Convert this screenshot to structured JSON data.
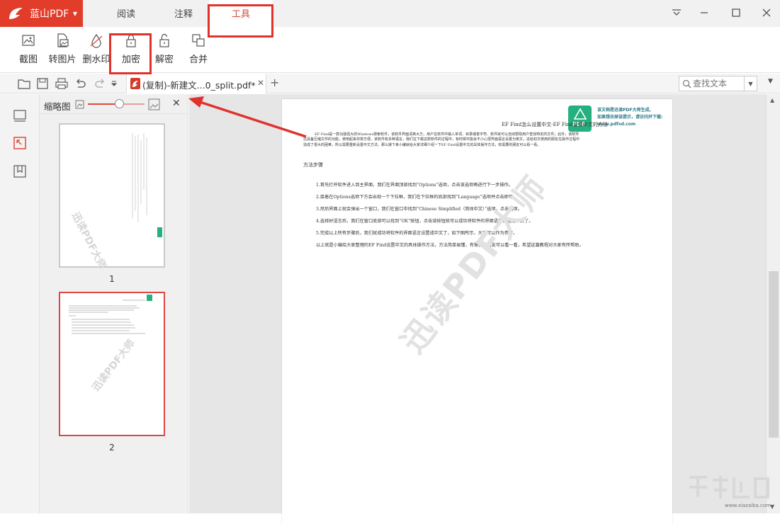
{
  "app": {
    "logo": "蓝山PDF"
  },
  "menu_tabs": [
    {
      "label": "阅读"
    },
    {
      "label": "注释"
    },
    {
      "label": "工具"
    }
  ],
  "toolbar": {
    "tools": [
      {
        "label": "截图",
        "icon": "screenshot-icon"
      },
      {
        "label": "转图片",
        "icon": "to-image-icon"
      },
      {
        "label": "删水印",
        "icon": "remove-watermark-icon"
      },
      {
        "label": "加密",
        "icon": "lock-icon"
      },
      {
        "label": "解密",
        "icon": "unlock-icon"
      },
      {
        "label": "合并",
        "icon": "merge-icon"
      }
    ]
  },
  "file_tab": {
    "label": "(复制)-新建文...0_split.pdf*"
  },
  "search": {
    "placeholder": "查找文本"
  },
  "thumbnails": {
    "title": "缩略图",
    "pages": [
      {
        "number": "1"
      },
      {
        "number": "2"
      }
    ],
    "zoom_level": 0.55
  },
  "document": {
    "title": "EF Find怎么设置中文-EF Find设置中文的方法",
    "intro": "EF Find是一款功能强大的Windows搜索软件，该软件界面清爽大方，用户在软件中输入单词、目录或者字符、软件就可以自动帮助用户查找特定的文件；此外，该软件还具备压缩文件的功能，使用起来非常方便。该软件有多种语言，我们在下载这款软件的过程中，有时候可能会不小心把界面语言设置为英文，这给初次使用的朋友在操作过程中造成了很大的困难，所以需要重新设置中文方法。那么接下来小编就给大家详细介绍一下EF Find设置中文的具体操作方法，有需要的朋友可以看一看。",
    "section": "方法步骤",
    "steps": [
      "1.首先打开软件进入到主界面，我们在界面顶部找到“Options”选项，点击该选项再进行下一步操作。",
      "2.接着在Options选项下方会出现一个下拉框，我们在下拉框的底部找到“Language”选项并点击即可。",
      "3.然后界面上就会弹出一个窗口，我们在窗口中找到“Chinese Simplified（简体中文）”选项，点击选项。",
      "4.选择好语言后，我们在窗口底部可以找到“OK”按钮，点击该按钮就可以成功将软件的界面语言设置成中文了。",
      "5.完成以上所有步骤后，我们就成功将软件的界面语言设置成中文了，如下图所示，大家可以作为参考。",
      "以上就是小编给大家整理的EF Find设置中文的具体操作方法，方法简单易懂，有需要的朋友可以看一看，希望这篇教程对大家有所帮助。"
    ],
    "promo_line1": "该文档是迅读PDF大师生成,",
    "promo_line2": "如果想去掉该提示，请访问并下载:",
    "promo_line3": "www.pdfxd.com",
    "badge": "PDF",
    "watermark": "迅读PDF大师"
  },
  "site_watermark": "www.xiazaiba.com",
  "colors": {
    "brand": "#e23c2a",
    "annotation": "#e0312d",
    "badge": "#25b17f"
  }
}
